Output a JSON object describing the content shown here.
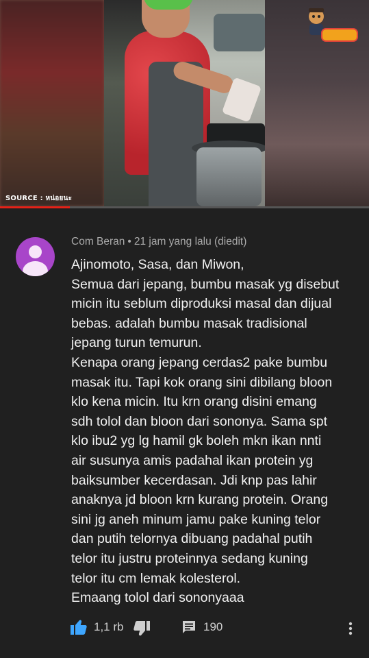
{
  "video": {
    "source_label": "SOURCE : หน่อยนะ",
    "watched_fraction": 0.19,
    "colors": {
      "progress": "#e62117"
    }
  },
  "comment": {
    "author": "Com Beran",
    "separator": "•",
    "timestamp": "21 jam yang lalu (diedit)",
    "avatar_color": "#a845c9",
    "lines": [
      "Ajinomoto, Sasa, dan Miwon,",
      "Semua dari jepang, bumbu masak yg disebut",
      "micin itu seblum diproduksi masal dan dijual",
      "bebas. adalah bumbu masak tradisional",
      "jepang turun temurun.",
      "Kenapa orang jepang cerdas2 pake bumbu",
      "masak itu. Tapi kok orang sini dibilang bloon",
      "klo kena micin. Itu krn orang disini emang",
      "sdh tolol dan bloon dari sononya. Sama spt",
      "klo ibu2 yg lg hamil gk boleh mkn ikan nnti",
      "air susunya amis padahal ikan protein yg",
      "baiksumber kecerdasan. Jdi knp pas lahir",
      "anaknya jd bloon krn kurang protein. Orang",
      "sini jg aneh minum jamu pake kuning telor",
      "dan putih telornya dibuang padahal putih",
      "telor itu justru proteinnya sedang kuning",
      "telor itu cm lemak kolesterol.",
      "Emaang tolol dari sononyaaa"
    ]
  },
  "actions": {
    "like_count": "1,1 rb",
    "reply_count": "190",
    "icons": {
      "like": "thumbs-up-icon",
      "dislike": "thumbs-down-icon",
      "reply": "reply-icon",
      "more": "more-vertical-icon"
    },
    "colors": {
      "like_active": "#3ea6ff",
      "icon": "#cfcfcf"
    }
  }
}
